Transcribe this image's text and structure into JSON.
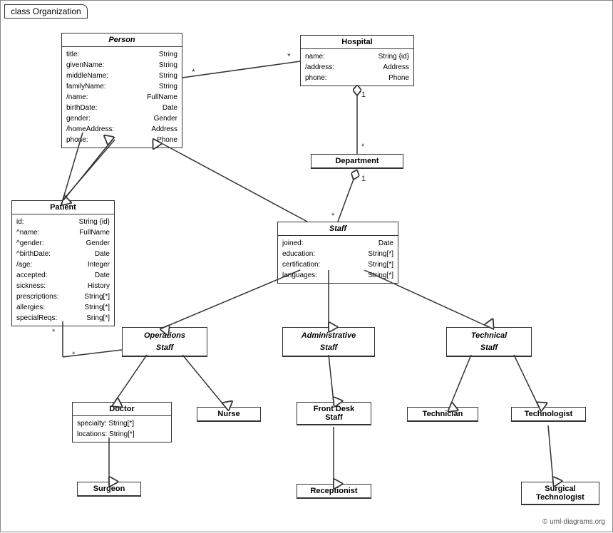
{
  "title": "class Organization",
  "copyright": "© uml-diagrams.org",
  "classes": {
    "person": {
      "name": "Person",
      "italic": true,
      "attrs": [
        [
          "title:",
          "String"
        ],
        [
          "givenName:",
          "String"
        ],
        [
          "middleName:",
          "String"
        ],
        [
          "familyName:",
          "String"
        ],
        [
          "/name:",
          "FullName"
        ],
        [
          "birthDate:",
          "Date"
        ],
        [
          "gender:",
          "Gender"
        ],
        [
          "/homeAddress:",
          "Address"
        ],
        [
          "phone:",
          "Phone"
        ]
      ]
    },
    "hospital": {
      "name": "Hospital",
      "italic": false,
      "attrs": [
        [
          "name:",
          "String {id}"
        ],
        [
          "/address:",
          "Address"
        ],
        [
          "phone:",
          "Phone"
        ]
      ]
    },
    "department": {
      "name": "Department",
      "italic": false,
      "attrs": []
    },
    "staff": {
      "name": "Staff",
      "italic": true,
      "attrs": [
        [
          "joined:",
          "Date"
        ],
        [
          "education:",
          "String[*]"
        ],
        [
          "certification:",
          "String[*]"
        ],
        [
          "languages:",
          "String[*]"
        ]
      ]
    },
    "patient": {
      "name": "Patient",
      "italic": false,
      "attrs": [
        [
          "id:",
          "String {id}"
        ],
        [
          "^name:",
          "FullName"
        ],
        [
          "^gender:",
          "Gender"
        ],
        [
          "^birthDate:",
          "Date"
        ],
        [
          "/age:",
          "Integer"
        ],
        [
          "accepted:",
          "Date"
        ],
        [
          "sickness:",
          "History"
        ],
        [
          "prescriptions:",
          "String[*]"
        ],
        [
          "allergies:",
          "String[*]"
        ],
        [
          "specialReqs:",
          "Sring[*]"
        ]
      ]
    },
    "operations_staff": {
      "name": "Operations\nStaff",
      "italic": true
    },
    "administrative_staff": {
      "name": "Administrative\nStaff",
      "italic": true
    },
    "technical_staff": {
      "name": "Technical\nStaff",
      "italic": true
    },
    "doctor": {
      "name": "Doctor",
      "italic": false,
      "attrs": [
        [
          "specialty: String[*]"
        ],
        [
          "locations: String[*]"
        ]
      ]
    },
    "nurse": {
      "name": "Nurse",
      "italic": false
    },
    "front_desk_staff": {
      "name": "Front Desk\nStaff",
      "italic": false
    },
    "technician": {
      "name": "Technician",
      "italic": false
    },
    "technologist": {
      "name": "Technologist",
      "italic": false
    },
    "surgeon": {
      "name": "Surgeon",
      "italic": false
    },
    "receptionist": {
      "name": "Receptionist",
      "italic": false
    },
    "surgical_technologist": {
      "name": "Surgical\nTechnologist",
      "italic": false
    }
  },
  "multiplicity": {
    "person_hospital_star_left": "*",
    "person_hospital_star_right": "*",
    "hospital_dept_1": "1",
    "hospital_dept_star": "*",
    "dept_staff_1": "1",
    "dept_staff_star": "*",
    "patient_person_star": "*",
    "patient_ops_star": "*"
  }
}
